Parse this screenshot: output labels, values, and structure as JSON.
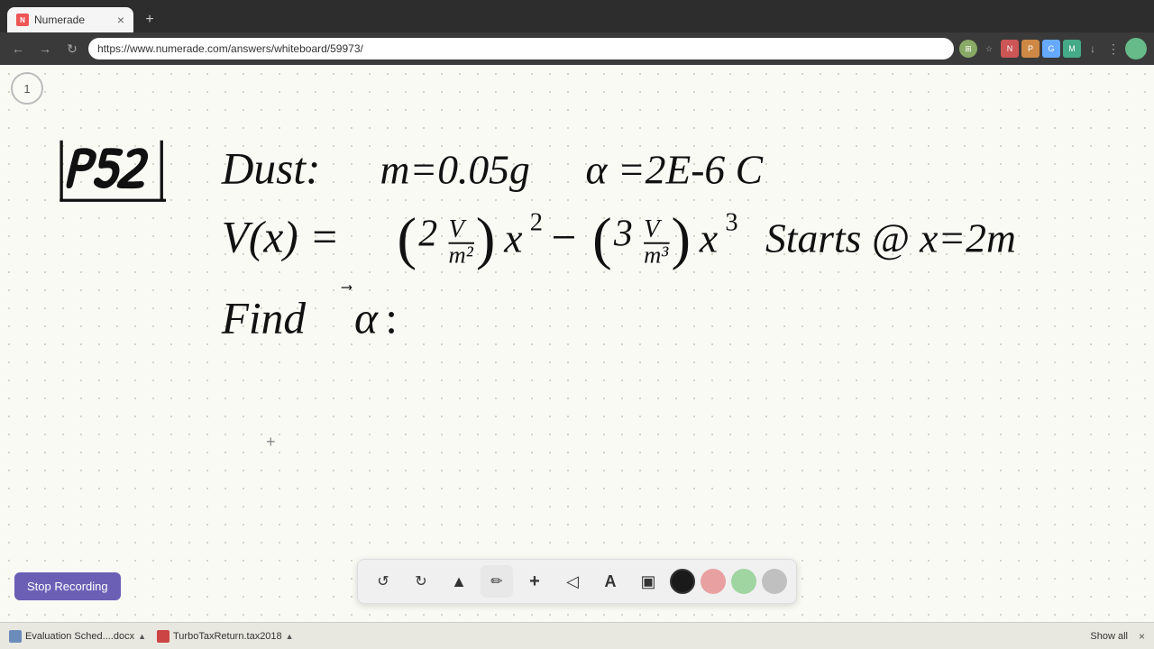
{
  "browser": {
    "tab_label": "Numerade",
    "tab_favicon": "N",
    "url": "https://www.numerade.com/answers/whiteboard/59973/",
    "new_tab_icon": "+",
    "nav_back": "←",
    "nav_forward": "→",
    "nav_refresh": "↻"
  },
  "page": {
    "page_number": "1",
    "plus_cursor": "+"
  },
  "toolbar": {
    "undo_label": "↺",
    "redo_label": "↻",
    "select_label": "▲",
    "pen_label": "✏",
    "plus_label": "+",
    "eraser_label": "◁",
    "text_label": "A",
    "image_label": "▣",
    "colors": [
      "#1a1a1a",
      "#e8a0a0",
      "#a0d4a0",
      "#c0c0c0"
    ],
    "color_names": [
      "black",
      "pink",
      "green",
      "gray"
    ]
  },
  "stop_recording": {
    "label": "Stop Recording"
  },
  "taskbar": {
    "item1_label": "Evaluation Sched....docx",
    "item2_label": "TurboTaxReturn.tax2018",
    "show_all": "Show all"
  }
}
